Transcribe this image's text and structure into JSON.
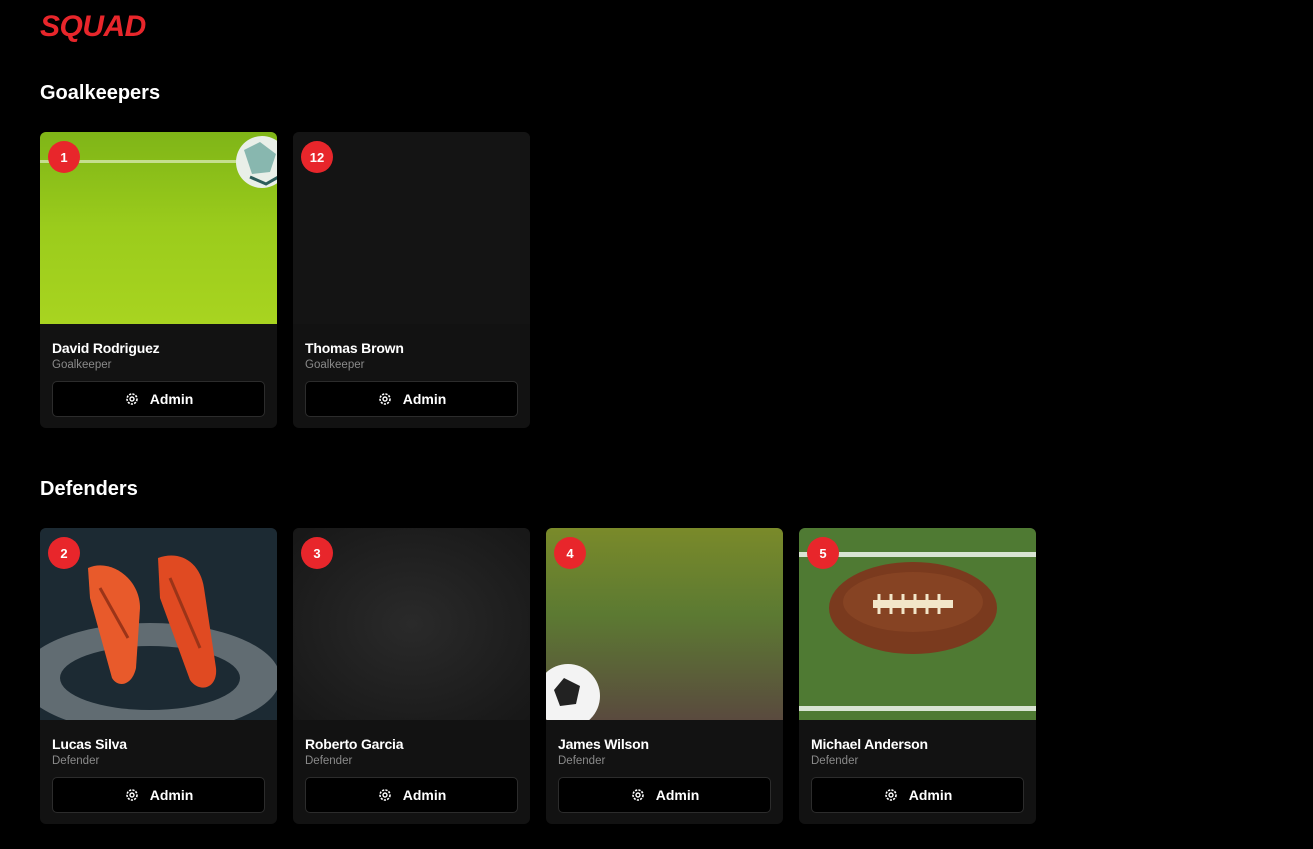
{
  "brand": {
    "title": "SQUAD"
  },
  "sections": [
    {
      "title": "Goalkeepers",
      "players": [
        {
          "number": "1",
          "name": "David Rodriguez",
          "position": "Goalkeeper",
          "action_label": "Admin",
          "action_icon": "gear-icon"
        },
        {
          "number": "12",
          "name": "Thomas Brown",
          "position": "Goalkeeper",
          "action_label": "Admin",
          "action_icon": "gear-icon"
        }
      ]
    },
    {
      "title": "Defenders",
      "players": [
        {
          "number": "2",
          "name": "Lucas Silva",
          "position": "Defender",
          "action_label": "Admin",
          "action_icon": "gear-icon"
        },
        {
          "number": "3",
          "name": "Roberto Garcia",
          "position": "Defender",
          "action_label": "Admin",
          "action_icon": "gear-icon"
        },
        {
          "number": "4",
          "name": "James Wilson",
          "position": "Defender",
          "action_label": "Admin",
          "action_icon": "gear-icon"
        },
        {
          "number": "5",
          "name": "Michael Anderson",
          "position": "Defender",
          "action_label": "Admin",
          "action_icon": "gear-icon"
        }
      ]
    }
  ],
  "colors": {
    "accent": "#e8262b",
    "background": "#000000",
    "card": "#121212",
    "muted_text": "#8a8a8a"
  }
}
